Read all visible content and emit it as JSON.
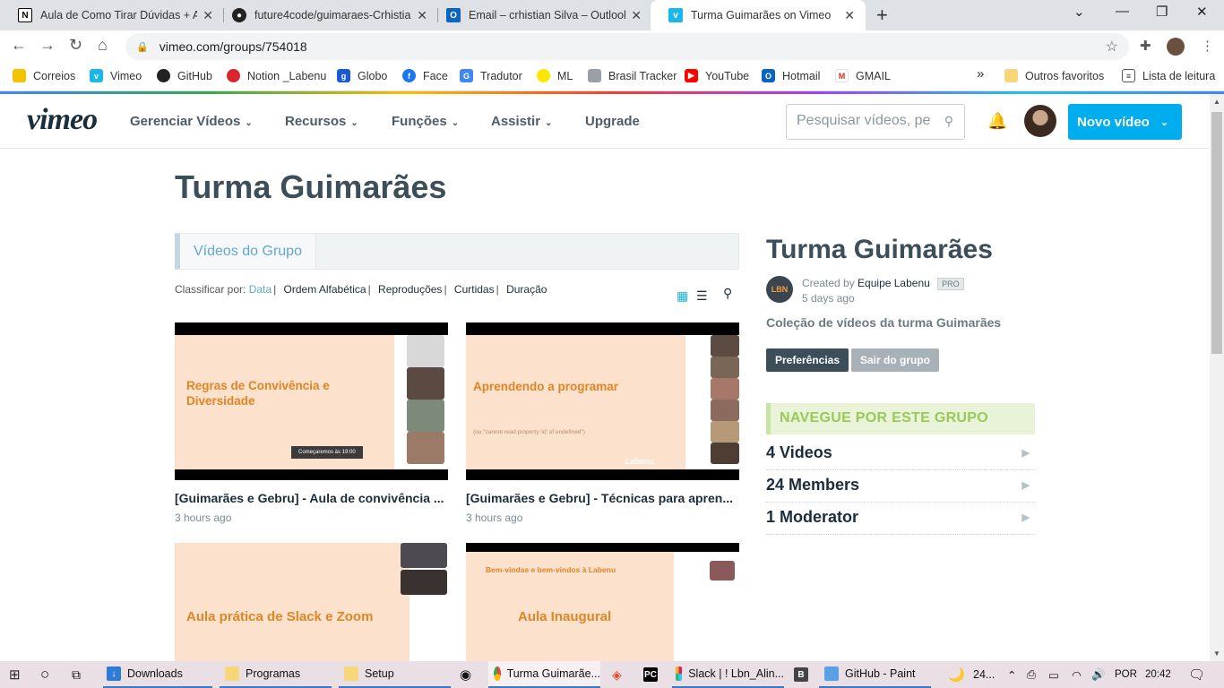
{
  "browser": {
    "tabs": [
      {
        "title": "Aula de Como Tirar Dúvidas + At",
        "icon": "notion-icon"
      },
      {
        "title": "future4code/guimaraes-Crhistian",
        "icon": "github-icon"
      },
      {
        "title": "Email – crhistian Silva – Outlook",
        "icon": "outlook-icon"
      },
      {
        "title": "Turma Guimarães on Vimeo",
        "icon": "vimeo-icon"
      }
    ],
    "new_tab": "+",
    "url": "vimeo.com/groups/754018",
    "bookmarks": [
      {
        "label": "Correios"
      },
      {
        "label": "Vimeo"
      },
      {
        "label": "GitHub"
      },
      {
        "label": "Notion _Labenu"
      },
      {
        "label": "Globo"
      },
      {
        "label": "Face"
      },
      {
        "label": "Tradutor"
      },
      {
        "label": "ML"
      },
      {
        "label": "Brasil Tracker"
      },
      {
        "label": "YouTube"
      },
      {
        "label": "Hotmail"
      },
      {
        "label": "GMAIL"
      }
    ],
    "bookmarks_more": "»",
    "other_favorites": "Outros favoritos",
    "reading_list": "Lista de leitura"
  },
  "vimeo": {
    "logo": "vimeo",
    "nav": [
      {
        "label": "Gerenciar Vídeos"
      },
      {
        "label": "Recursos"
      },
      {
        "label": "Funções"
      },
      {
        "label": "Assistir"
      },
      {
        "label": "Upgrade"
      }
    ],
    "search_placeholder": "Pesquisar vídeos, pe",
    "new_video": "Novo vídeo"
  },
  "page": {
    "title": "Turma Guimarães",
    "group_tab": "Vídeos do Grupo",
    "sort_label": "Classificar por:",
    "sort_options": [
      "Data",
      "Ordem Alfabética",
      "Reproduções",
      "Curtidas",
      "Duração"
    ],
    "videos": [
      {
        "title": "[Guimarães e Gebru] - Aula de convivência ...",
        "time": "3 hours ago",
        "slide_text": "Regras de Convivência e Diversidade",
        "badge": "Começaremos às 19:00"
      },
      {
        "title": "[Guimarães e Gebru] - Técnicas para apren...",
        "time": "3 hours ago",
        "slide_text": "Aprendendo a programar",
        "sub_text": "(ou \"cannot read property 'id' of undefined\")",
        "brand": "Labenu"
      },
      {
        "title": "",
        "time": "",
        "slide_text": "Aula prática de Slack e Zoom"
      },
      {
        "title": "",
        "time": "",
        "slide_text": "Aula Inaugural",
        "top_text": "Bem-vindas e bem-vindos à Labenu"
      }
    ]
  },
  "sidebar": {
    "title": "Turma Guimarães",
    "created_by_prefix": "Created by",
    "creator": "Equipe Labenu",
    "pro_badge": "PRO",
    "created_ago": "5 days ago",
    "description": "Coleção de vídeos da turma Guimarães",
    "btn_preferences": "Preferências",
    "btn_leave": "Sair do grupo",
    "browse_heading": "NAVEGUE POR ESTE GRUPO",
    "stats": [
      {
        "label": "4 Videos"
      },
      {
        "label": "24 Members"
      },
      {
        "label": "1 Moderator"
      }
    ],
    "arrow": "▶"
  },
  "taskbar": {
    "items": [
      {
        "label": "Downloads"
      },
      {
        "label": "Programas"
      },
      {
        "label": "Setup"
      },
      {
        "label": "Turma Guimarãe..."
      },
      {
        "label": "Slack | ! Lbn_Alin..."
      },
      {
        "label": "GitHub - Paint"
      }
    ],
    "weather": "24...",
    "language": "POR",
    "clock": "20:42"
  },
  "colors": {
    "vimeo_blue": "#00adef",
    "link_blue": "#5fa8d3",
    "browse_green": "#9ac95b",
    "slide_peach": "#fce1cd",
    "slide_orange": "#e08524"
  }
}
